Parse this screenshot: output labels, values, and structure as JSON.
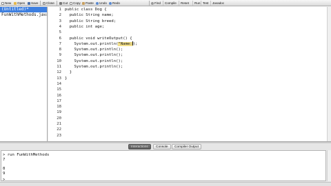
{
  "toolbar": {
    "new": "New",
    "open": "Open",
    "save": "Save",
    "close": "Close",
    "cut": "Cut",
    "copy": "Copy",
    "paste": "Paste",
    "undo": "Undo",
    "redo": "Redo",
    "find": "Find",
    "compile": "Compile",
    "reset": "Reset",
    "run": "Run",
    "test": "Test",
    "javadoc": "Javadoc"
  },
  "files": [
    {
      "name": "(Untitled)*",
      "selected": true
    },
    {
      "name": "FunWithMethods.java",
      "selected": false
    }
  ],
  "editor": {
    "line_numbers": [
      "1",
      "2",
      "3",
      "4",
      "5",
      "6",
      "7",
      "8",
      "9",
      "10",
      "11",
      "12",
      "13",
      "14",
      "15",
      "16",
      "17",
      "18",
      "19",
      "20",
      "21",
      "22",
      "23"
    ],
    "lines": [
      "public class Dog {",
      "  public String name;",
      "  public String breed;",
      "  public int age;",
      "",
      "  public void writeOutput() {",
      "    System.out.println(",
      "    System.out.println();",
      "    System.out.println();",
      "    System.out.println();",
      "    System.out.println();",
      "  }",
      "}"
    ],
    "line7_string": "\"Name:",
    "line7_tail": ");"
  },
  "tabs": {
    "interactions": "Interactions",
    "console": "Console",
    "compiler_output": "Compiler Output"
  },
  "console": {
    "lines": [
      "> run FunWithMethods",
      "7",
      "",
      "8",
      "9",
      "",
      ">"
    ]
  },
  "colors": {
    "selection": "#3d7fe0",
    "string_highlight": "#f3e08a",
    "active_tab": "#5a5a5a"
  }
}
